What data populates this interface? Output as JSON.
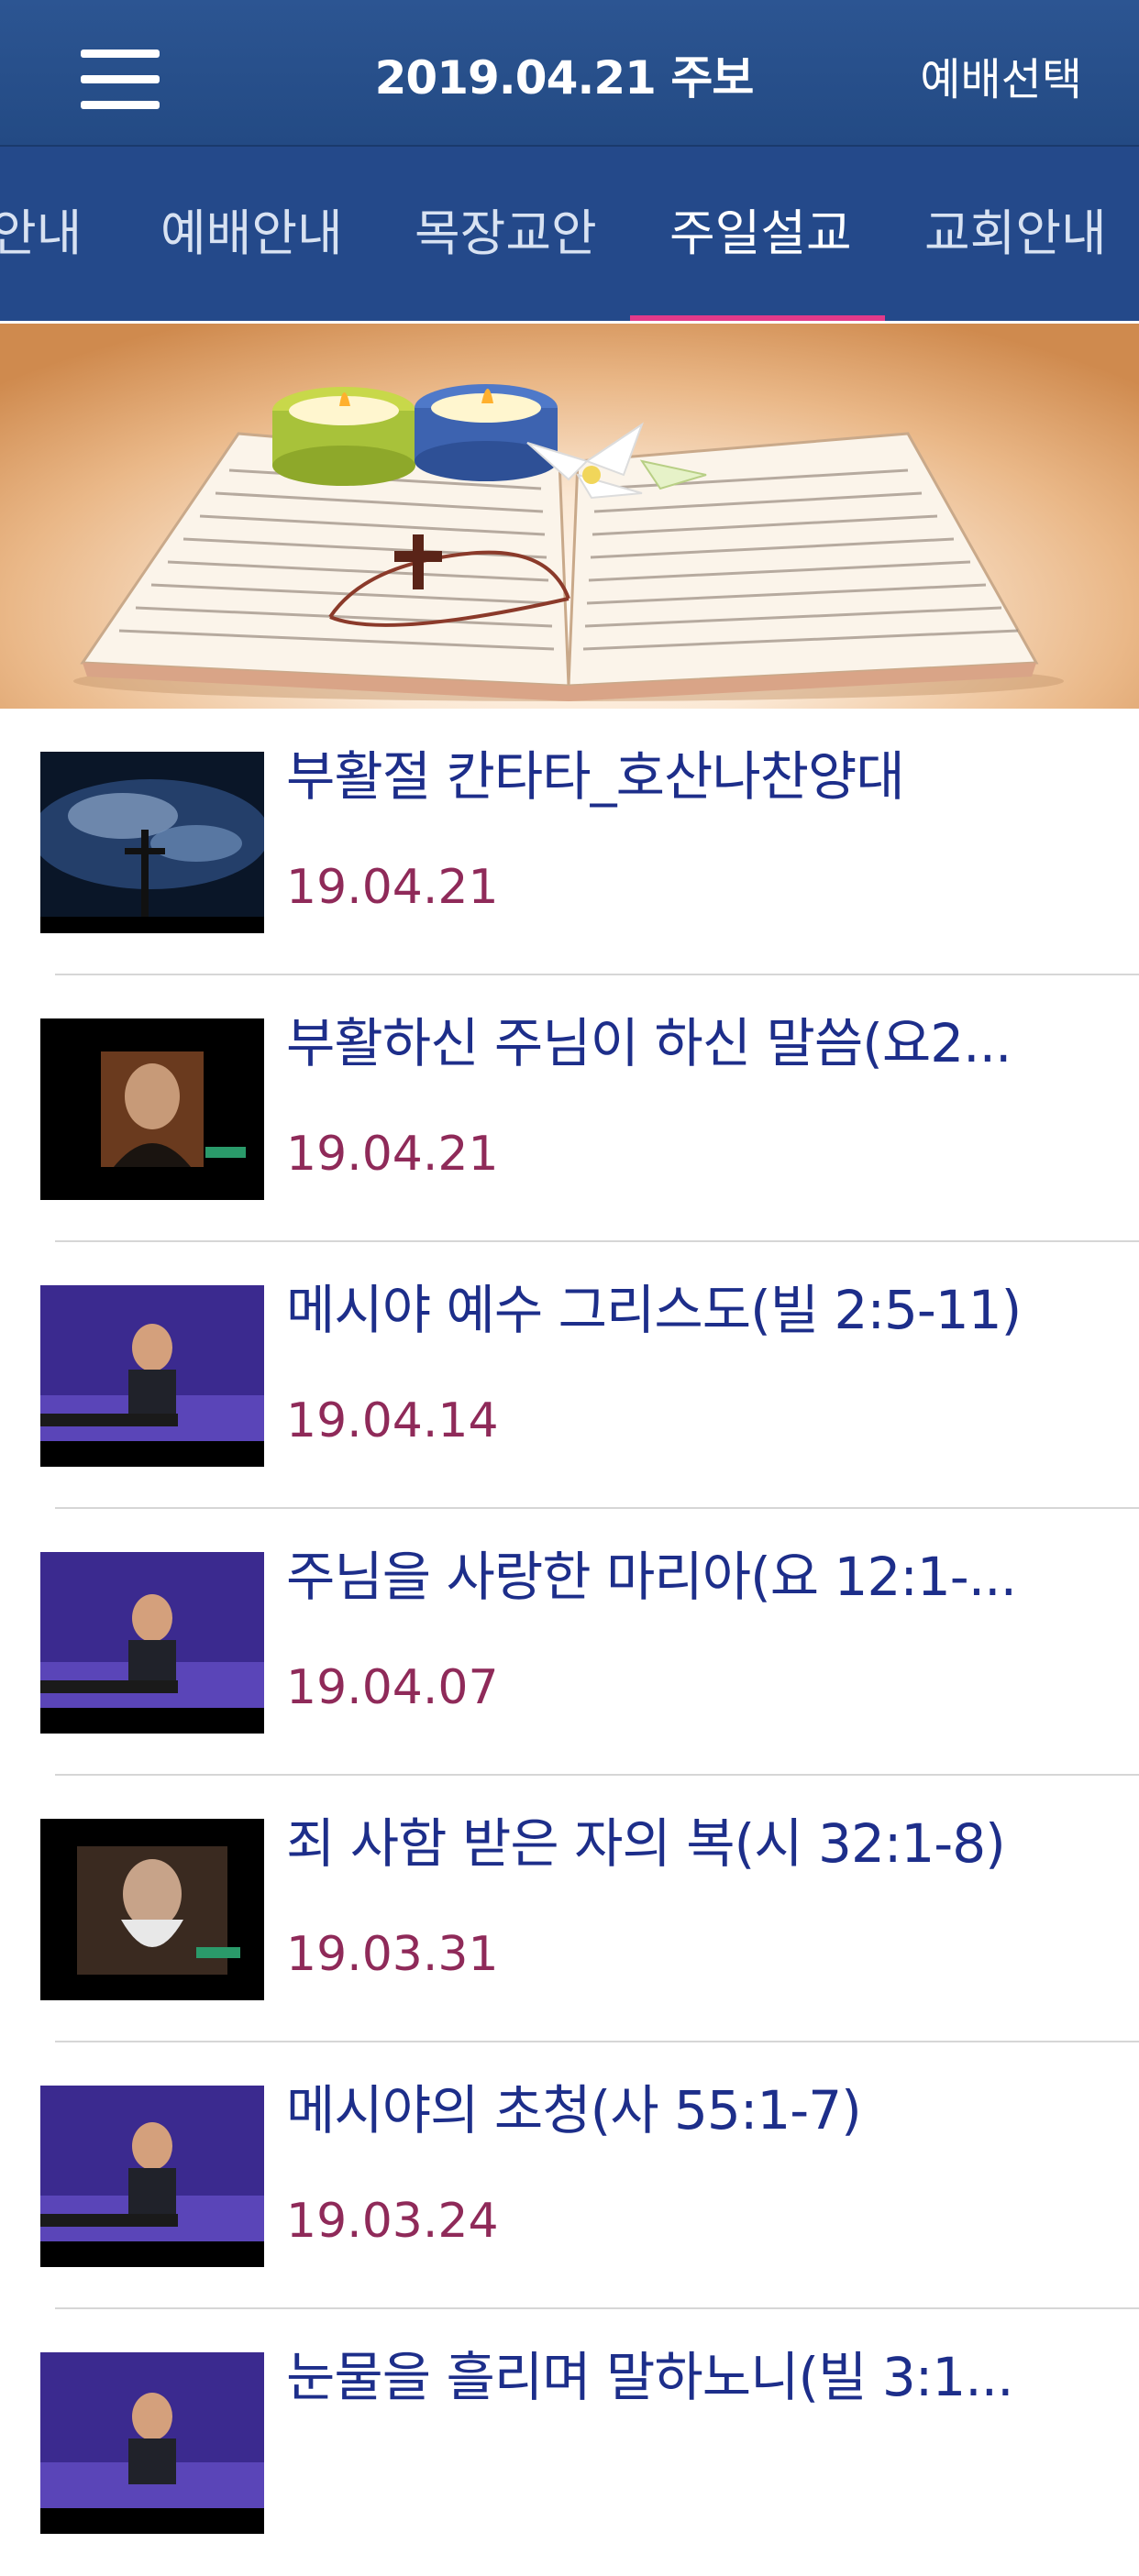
{
  "header": {
    "title": "2019.04.21 주보",
    "service_select": "예배선택",
    "menu_icon": "hamburger-icon"
  },
  "tabs": [
    {
      "label": "안내"
    },
    {
      "label": "예배안내"
    },
    {
      "label": "목장교안"
    },
    {
      "label": "주일설교",
      "active": true
    },
    {
      "label": "교회안내"
    }
  ],
  "sermons": [
    {
      "title": "부활절 칸타타_호산나찬양대",
      "date": "19.04.21"
    },
    {
      "title": "부활하신 주님이 하신 말씀(요2...",
      "date": "19.04.21"
    },
    {
      "title": "메시야 예수 그리스도(빌 2:5-11)",
      "date": "19.04.14"
    },
    {
      "title": "주님을 사랑한 마리아(요 12:1-...",
      "date": "19.04.07"
    },
    {
      "title": "죄 사함 받은 자의 복(시 32:1-8)",
      "date": "19.03.31"
    },
    {
      "title": "메시야의 초청(사 55:1-7)",
      "date": "19.03.24"
    },
    {
      "title": "눈물을 흘리며 말하노니(빌 3:1...",
      "date": ""
    }
  ],
  "colors": {
    "header_bg": "#2c5592",
    "tab_bg": "#24498a",
    "tab_indicator": "#e23a8a",
    "title_text": "#1d2e8a",
    "date_text": "#8f2a59"
  }
}
